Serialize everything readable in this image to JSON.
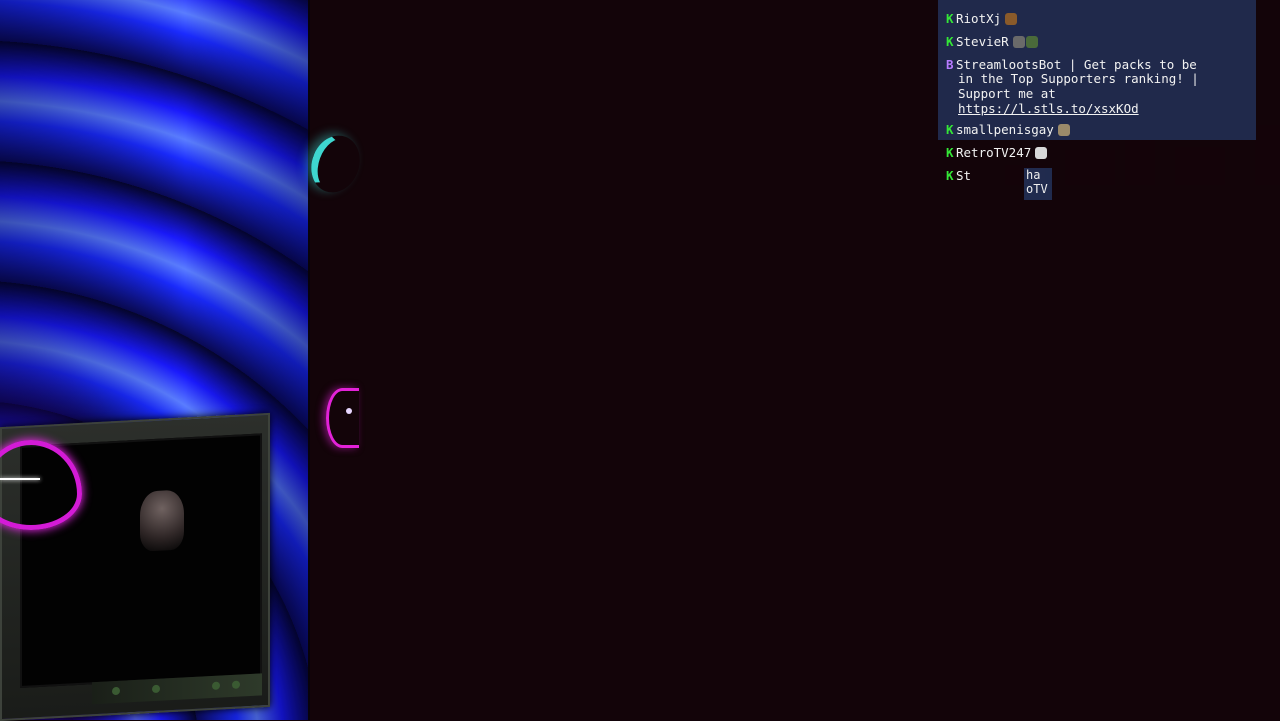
{
  "chat": {
    "messages": [
      {
        "user": "RiotXj",
        "text": ""
      },
      {
        "user": "StevieR",
        "text": ""
      },
      {
        "user": "StreamlootsBot",
        "text_lines": [
          "StreamlootsBot | Get packs to be",
          "in the Top Supporters ranking! |",
          "Support me at"
        ],
        "link": "https://l.stls.to/xsxKOd"
      },
      {
        "user": "smallpenisgay",
        "text": ""
      },
      {
        "user": "RetroTV247",
        "text": ""
      },
      {
        "user": "St",
        "text": "ha",
        "text2": "oTV"
      }
    ]
  },
  "colors": {
    "chat_bg": "#23325a",
    "badge_green": "#34e637",
    "badge_purple": "#b77bff",
    "neon_pink": "#d31bd6",
    "neon_teal": "#3ed7d0"
  }
}
